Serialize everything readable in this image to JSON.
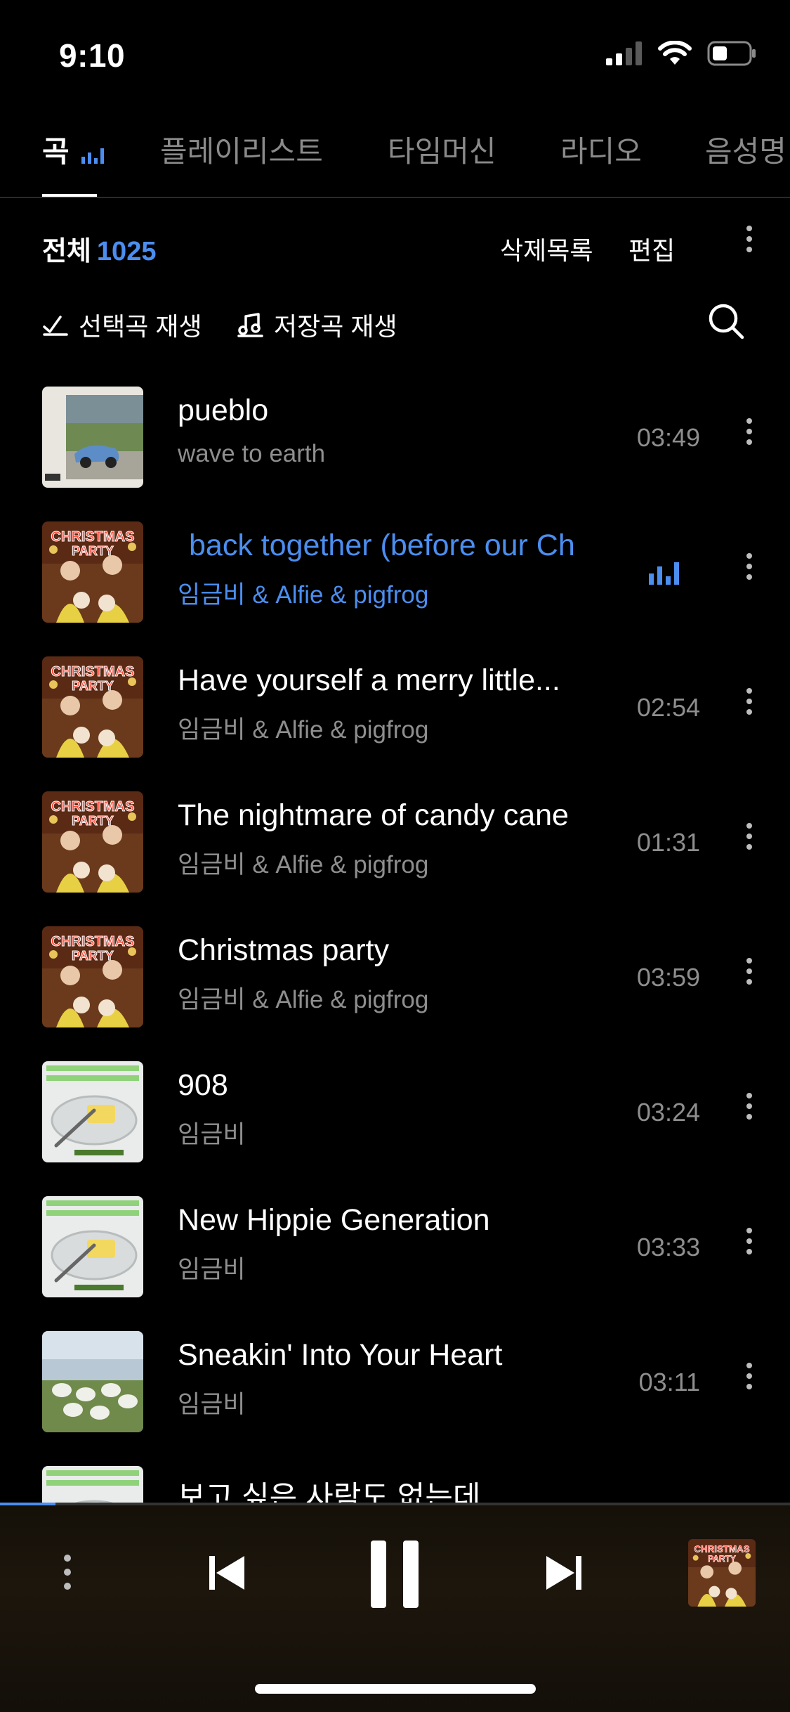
{
  "status": {
    "time": "9:10",
    "icons": [
      "signal-icon",
      "wifi-icon",
      "battery-icon"
    ]
  },
  "tabs": [
    {
      "label": "곡",
      "active": true
    },
    {
      "label": "플레이리스트",
      "active": false
    },
    {
      "label": "타임머신",
      "active": false
    },
    {
      "label": "라디오",
      "active": false
    },
    {
      "label": "음성명",
      "active": false
    }
  ],
  "toolbar": {
    "total_label": "전체",
    "total_count": "1025",
    "deleted_label": "삭제목록",
    "edit_label": "편집"
  },
  "actions": {
    "play_selected": "선택곡 재생",
    "play_saved": "저장곡 재생"
  },
  "songs": [
    {
      "title": "pueblo",
      "artist": "wave to earth",
      "duration": "03:49",
      "art": "pueblo"
    },
    {
      "title": "back together (before our Ch",
      "artist": "임금비 & Alfie & pigfrog",
      "duration": "",
      "playing": true,
      "art": "christmas"
    },
    {
      "title": "Have yourself a merry little...",
      "artist": "임금비 & Alfie & pigfrog",
      "duration": "02:54",
      "art": "christmas"
    },
    {
      "title": "The nightmare of candy cane",
      "artist": "임금비 & Alfie & pigfrog",
      "duration": "01:31",
      "art": "christmas"
    },
    {
      "title": "Christmas party",
      "artist": "임금비 & Alfie & pigfrog",
      "duration": "03:59",
      "art": "christmas"
    },
    {
      "title": "908",
      "artist": "임금비",
      "duration": "03:24",
      "art": "butter"
    },
    {
      "title": "New Hippie Generation",
      "artist": "임금비",
      "duration": "03:33",
      "art": "butter"
    },
    {
      "title": "Sneakin' Into Your Heart",
      "artist": "임금비",
      "duration": "03:11",
      "art": "sheep"
    },
    {
      "title": "보고 싶은 사람도 없는데",
      "artist": "",
      "duration": "",
      "art": "butter"
    }
  ],
  "player": {
    "progress": 0.07
  },
  "colors": {
    "accent": "#4b8ef0",
    "background": "#000000"
  }
}
